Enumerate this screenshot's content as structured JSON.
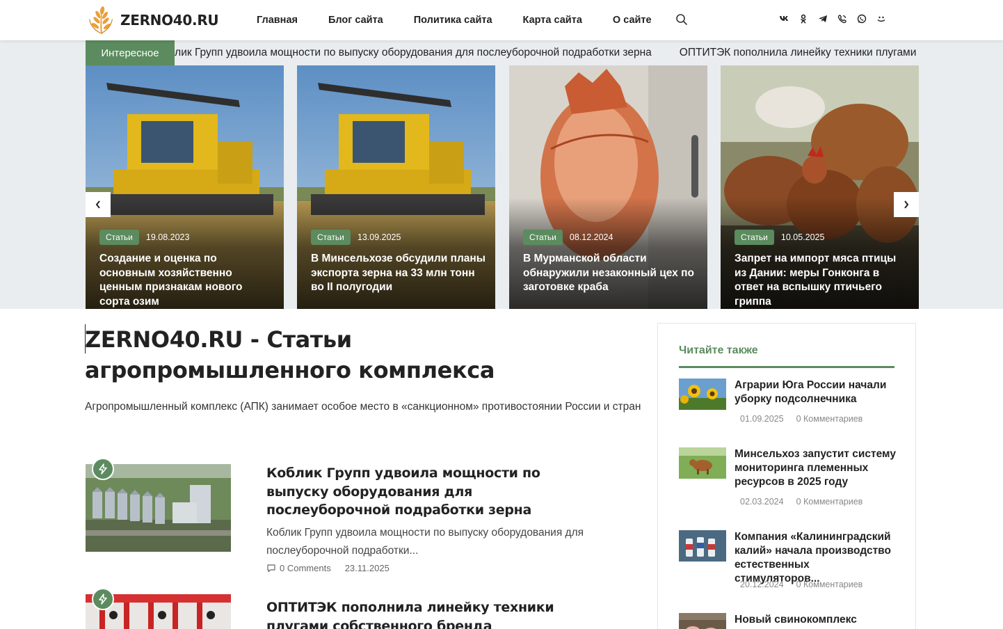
{
  "site": {
    "logo_text": "ZERNO40.RU",
    "accent_color": "#5b8b5e"
  },
  "nav": [
    {
      "label": "Главная"
    },
    {
      "label": "Блог сайта"
    },
    {
      "label": "Политика сайта"
    },
    {
      "label": "Карта сайта"
    },
    {
      "label": "О сайте"
    }
  ],
  "header_icons": [
    "search-icon",
    "vk-icon",
    "odnoklassniki-icon",
    "telegram-icon",
    "viber-icon",
    "whatsapp-icon",
    "moimir-icon"
  ],
  "ticker": {
    "label": "Интересное",
    "items": [
      "блик Групп удвоила мощности по выпуску оборудования для послеуборочной подработки зерна",
      "ОПТИТЭК пополнила линейку техники плугами собственного бренда"
    ]
  },
  "slider": {
    "slides": [
      {
        "category": "Статьи",
        "date": "19.08.2023",
        "title": "Создание и оценка по основным хозяйственно ценным признакам нового сорта озим",
        "image": "combine-harvester"
      },
      {
        "category": "Статьи",
        "date": "13.09.2025",
        "title": "В Минсельхозе обсудили планы экспорта зерна на 33 млн тонн во II полугодии",
        "image": "combine-harvester"
      },
      {
        "category": "Статьи",
        "date": "08.12.2024",
        "title": "В Мурманской области обнаружили незаконный цех по заготовке краба",
        "image": "crab"
      },
      {
        "category": "Статьи",
        "date": "10.05.2025",
        "title": "Запрет на импорт мяса птицы из Дании: меры Гонконга в ответ на вспышку птичьего гриппа",
        "image": "chickens"
      }
    ],
    "prev_icon": "chevron-left-icon",
    "next_icon": "chevron-right-icon"
  },
  "main": {
    "title": "ZERNO40.RU - Статьи агропромышленного комплекса",
    "intro": "Агропромышленный комплекс (АПК) занимает особое место в «санкционном» противостоянии России и стран",
    "posts": [
      {
        "title": "Коблик Групп удвоила мощности по выпуску оборудования для послеуборочной подработки зерна",
        "excerpt": "Коблик Групп удвоила мощности по выпуску оборудования для послеуборочной подработки...",
        "comments": "0 Comments",
        "date": "23.11.2025",
        "image": "grain-silos"
      },
      {
        "title": "ОПТИТЭК пополнила линейку техники плугами собственного бренда",
        "excerpt": "",
        "comments": "",
        "date": "",
        "image": "red-plough"
      }
    ]
  },
  "sidebar": {
    "title": "Читайте также",
    "items": [
      {
        "title": "Аграрии Юга России начали уборку подсолнечника",
        "date": "01.09.2025",
        "comments": "0 Комментариев",
        "image": "sunflowers"
      },
      {
        "title": "Минсельхоз запустит систему мониторинга племенных ресурсов в 2025 году",
        "date": "02.03.2024",
        "comments": "0 Комментариев",
        "image": "cow"
      },
      {
        "title": "Компания «Калининградский калий» начала производство естественных стимуляторов...",
        "date": "20.12.2024",
        "comments": "0 Комментариев",
        "image": "bottles"
      },
      {
        "title": "Новый свинокомплекс",
        "date": "",
        "comments": "",
        "image": "pig-farm"
      }
    ]
  }
}
